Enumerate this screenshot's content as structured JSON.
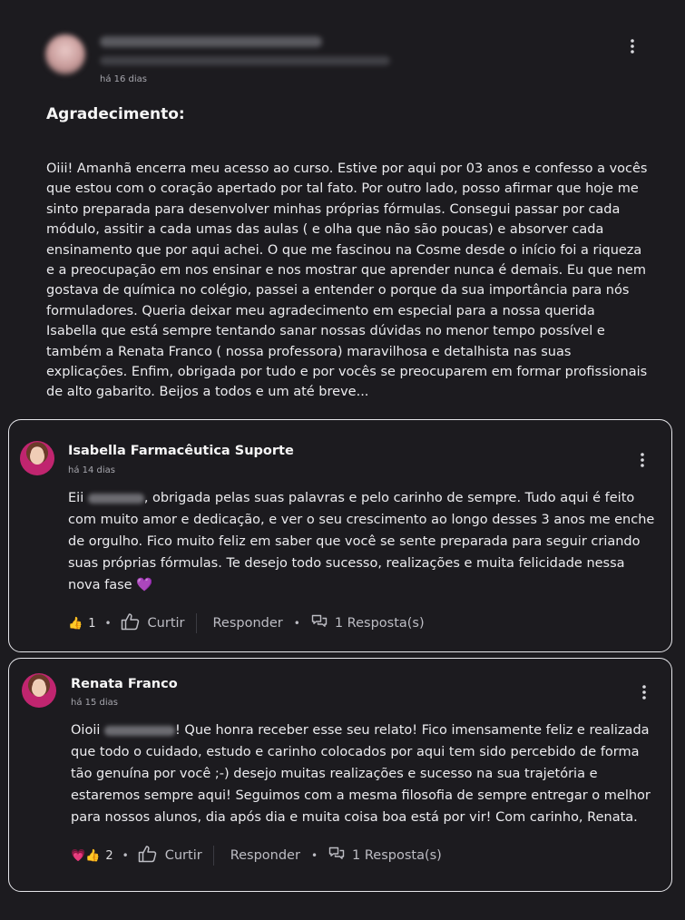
{
  "post": {
    "time": "há 16 dias",
    "title": "Agradecimento:",
    "body": "Oiii! Amanhã encerra meu acesso ao curso. Estive por aqui por 03 anos e confesso a vocês que estou com o coração apertado por tal fato. Por outro lado, posso afirmar que hoje me sinto preparada para desenvolver minhas próprias fórmulas. Consegui passar por cada módulo, assitir a cada umas das aulas ( e olha que não são poucas) e absorver cada ensinamento que por aqui achei. O que me fascinou na Cosme desde o início foi a riqueza e a preocupação em nos ensinar e nos mostrar que aprender nunca é demais. Eu que nem gostava de química no colégio, passei a entender o porque da sua importância para nós formuladores. Queria deixar meu agradecimento em especial para a nossa querida Isabella que está sempre tentando sanar nossas dúvidas no menor tempo possível e também a Renata Franco ( nossa professora) maravilhosa e detalhista nas suas explicações. Enfim, obrigada por tudo e por vocês se preocuparem em formar profissionais de alto gabarito. Beijos a todos e um até breve..."
  },
  "comments": [
    {
      "author": "Isabella Farmacêutica Suporte",
      "time": "há 14 dias",
      "text_prefix": "Eii ",
      "text_rest": ", obrigada pelas suas palavras e pelo carinho de sempre. Tudo aqui é feito com muito amor e dedicação, e ver o seu crescimento ao longo desses 3 anos me enche de orgulho. Fico muito feliz em saber que você se sente preparada para seguir criando suas próprias fórmulas. Te desejo todo sucesso, realizações e muita felicidade nessa nova fase 💜",
      "reactions": "👍",
      "reaction_count": "1",
      "like_label": "Curtir",
      "reply_label": "Responder",
      "replies_label": "1 Resposta(s)"
    },
    {
      "author": "Renata Franco",
      "time": "há 15 dias",
      "text_prefix": "Oioii ",
      "text_rest": "! Que honra receber esse seu relato! Fico imensamente feliz e realizada que todo o cuidado, estudo e carinho colocados por aqui tem sido percebido de forma tão genuína por você ;-) desejo muitas realizações e sucesso na sua trajetória e estaremos sempre aqui! Seguimos com a mesma filosofia de sempre entregar o melhor para nossos alunos, dia após dia e muita coisa boa está por vir! Com carinho, Renata.",
      "reactions": "💗👍",
      "reaction_count": "2",
      "like_label": "Curtir",
      "reply_label": "Responder",
      "replies_label": "1 Resposta(s)"
    }
  ]
}
